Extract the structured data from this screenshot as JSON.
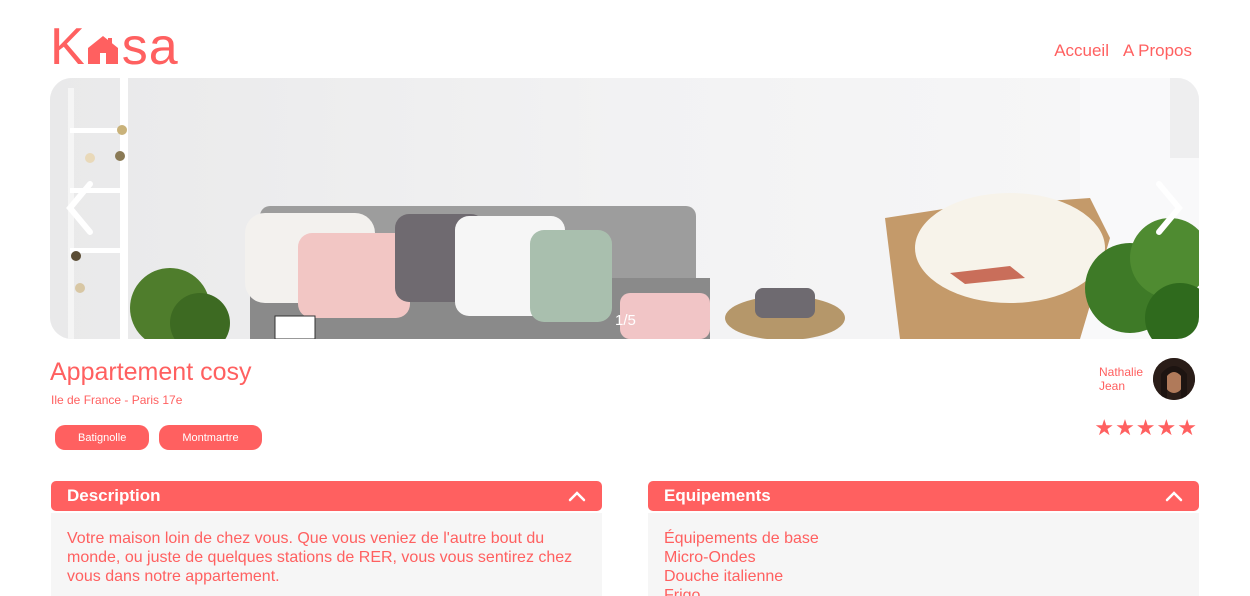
{
  "header": {
    "logo_left": "K",
    "logo_right": "sa",
    "nav": [
      {
        "label": "Accueil"
      },
      {
        "label": "A Propos"
      }
    ]
  },
  "carousel": {
    "counter": "1/5"
  },
  "listing": {
    "title": "Appartement cosy",
    "location": "Ile de France - Paris 17e",
    "tags": [
      "Batignolle",
      "Montmartre"
    ],
    "host": {
      "first_name": "Nathalie",
      "last_name": "Jean"
    },
    "rating": 5
  },
  "description": {
    "title": "Description",
    "text": "Votre maison loin de chez vous. Que vous veniez de l'autre bout du monde, ou juste de quelques stations de RER, vous vous sentirez chez vous dans notre appartement."
  },
  "equipments": {
    "title": "Equipements",
    "items": [
      "Équipements de base",
      "Micro-Ondes",
      "Douche italienne",
      "Frigo"
    ]
  },
  "colors": {
    "accent": "#FF6060",
    "panel": "#F6F6F6"
  }
}
